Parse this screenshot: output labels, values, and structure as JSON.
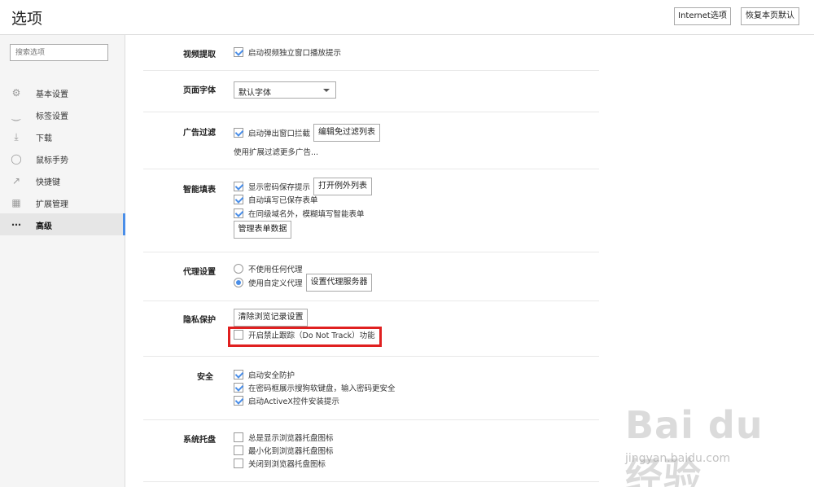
{
  "header": {
    "title": "选项",
    "internet_options": "Internet选项",
    "reset_defaults": "恢复本页默认"
  },
  "sidebar": {
    "search_placeholder": "搜索选项",
    "items": [
      {
        "label": "基本设置",
        "icon": "gear-icon"
      },
      {
        "label": "标签设置",
        "icon": "tab-icon"
      },
      {
        "label": "下载",
        "icon": "download-icon"
      },
      {
        "label": "鼠标手势",
        "icon": "mouse-icon"
      },
      {
        "label": "快捷键",
        "icon": "shortcut-icon"
      },
      {
        "label": "扩展管理",
        "icon": "extensions-icon"
      },
      {
        "label": "高级",
        "icon": "more-icon"
      }
    ],
    "active_item": "高级",
    "accent_color": "#4a8ee8"
  },
  "sections": {
    "video": {
      "title": "视频提取",
      "options": [
        {
          "label": "启动视频独立窗口播放提示",
          "checked": true
        }
      ]
    },
    "font": {
      "title": "页面字体",
      "select_value": "默认字体"
    },
    "adblock": {
      "title": "广告过滤",
      "options": [
        {
          "label": "启动弹出窗口拦截",
          "checked": true
        }
      ],
      "button": "编辑免过滤列表",
      "note": "使用扩展过滤更多广告..."
    },
    "autofill": {
      "title": "智能填表",
      "options": [
        {
          "label": "显示密码保存提示",
          "checked": true
        },
        {
          "label": "自动填写已保存表单",
          "checked": true
        },
        {
          "label": "在同级域名外，模糊填写智能表单",
          "checked": true
        }
      ],
      "button_exceptions": "打开例外列表",
      "button_manage": "管理表单数据"
    },
    "proxy": {
      "title": "代理设置",
      "options": [
        {
          "label": "不使用任何代理",
          "selected": false
        },
        {
          "label": "使用自定义代理",
          "selected": true
        }
      ],
      "button": "设置代理服务器"
    },
    "privacy": {
      "title": "隐私保护",
      "button": "清除浏览记录设置",
      "options": [
        {
          "label": "开启禁止跟踪（Do Not Track）功能",
          "checked": false
        }
      ],
      "highlight_color": "#e02020"
    },
    "security": {
      "title": "安全",
      "options": [
        {
          "label": "启动安全防护",
          "checked": true
        },
        {
          "label": "在密码框展示搜狗软键盘，输入密码更安全",
          "checked": true
        },
        {
          "label": "启动ActiveX控件安装提示",
          "checked": true
        }
      ]
    },
    "tray": {
      "title": "系统托盘",
      "options": [
        {
          "label": "总是显示浏览器托盘图标",
          "checked": false
        },
        {
          "label": "最小化到浏览器托盘图标",
          "checked": false
        },
        {
          "label": "关闭到浏览器托盘图标",
          "checked": false
        }
      ]
    }
  },
  "watermark": {
    "main": "Bai du 经验",
    "sub": "jingyan.baidu.com"
  }
}
